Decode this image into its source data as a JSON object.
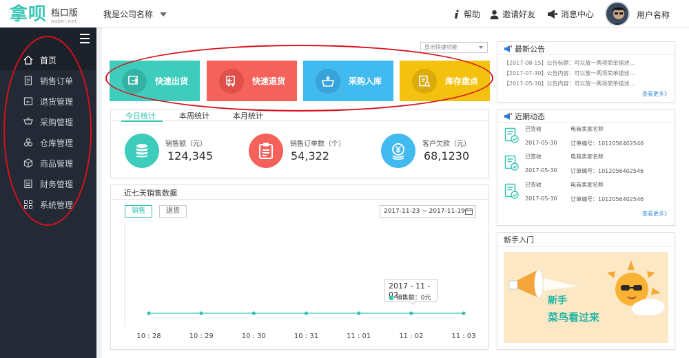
{
  "brand": {
    "logo_text": "拿呗",
    "sub": "档口版",
    "domain": "nabei.net",
    "color": "#3cc7b6"
  },
  "header": {
    "company": "我是公司名称",
    "nav": [
      {
        "label": "帮助",
        "icon": "info-icon"
      },
      {
        "label": "邀请好友",
        "icon": "user-icon"
      },
      {
        "label": "消息中心",
        "icon": "megaphone-icon"
      }
    ],
    "username": "用户名称"
  },
  "sidebar": {
    "items": [
      {
        "label": "首页",
        "icon": "home-icon",
        "active": true
      },
      {
        "label": "销售订单",
        "icon": "document-icon"
      },
      {
        "label": "退货管理",
        "icon": "return-icon"
      },
      {
        "label": "采购管理",
        "icon": "cart-icon"
      },
      {
        "label": "仓库管理",
        "icon": "boxes-icon"
      },
      {
        "label": "商品管理",
        "icon": "cube-icon"
      },
      {
        "label": "财务管理",
        "icon": "ledger-icon"
      },
      {
        "label": "系统管理",
        "icon": "grid-icon"
      }
    ]
  },
  "quick": {
    "selector": "显示快捷功能",
    "buttons": [
      {
        "label": "快速出货",
        "color": "#3ecdbc",
        "icon": "truck-out-icon"
      },
      {
        "label": "快速退货",
        "color": "#f5625b",
        "icon": "truck-return-icon"
      },
      {
        "label": "采购入库",
        "color": "#41baf0",
        "icon": "basket-icon"
      },
      {
        "label": "库存盘点",
        "color": "#f4c10f",
        "icon": "inventory-check-icon"
      }
    ]
  },
  "stats": {
    "tabs": [
      "今日统计",
      "本周统计",
      "本月统计"
    ],
    "items": [
      {
        "label": "销售额（元）",
        "value": "124,345",
        "color": "#3ecdbc",
        "icon": "coins-icon"
      },
      {
        "label": "销售订单数（个）",
        "value": "54,322",
        "color": "#f5625b",
        "icon": "clipboard-icon"
      },
      {
        "label": "客户欠款（元）",
        "value": "68,1230",
        "color": "#41baf0",
        "icon": "yen-coins-icon"
      }
    ]
  },
  "chart": {
    "title": "近七天销售数据",
    "toggle": [
      "销售",
      "退货"
    ],
    "date_range": "2017-11-23 ~ 2017-11-19",
    "tooltip": {
      "date": "2017 - 11 - 02",
      "label": "销售额：0元"
    }
  },
  "chart_data": {
    "type": "line",
    "x": [
      "10 : 28",
      "10 : 29",
      "10 : 30",
      "10 : 31",
      "11 : 01",
      "11 : 02",
      "11 : 03"
    ],
    "series": [
      {
        "name": "销售额",
        "values": [
          0,
          0,
          0,
          0,
          0,
          0,
          0
        ],
        "color": "#36c3b2"
      }
    ]
  },
  "announcements": {
    "title": "最新公告",
    "items": [
      "【2017-08-15】公告标题：可以放一两项简单描述...",
      "【2017-07-30】公告内容：可以放一两项简单描述...",
      "【2017-05-30】公告内容：可以放一两项简单描述..."
    ],
    "more": "查看更多》"
  },
  "activity": {
    "title": "近期动态",
    "items": [
      {
        "status": "已签收",
        "date": "2017-05-30",
        "seller": "电商卖家名称",
        "order": "订单编号：1012056402546"
      },
      {
        "status": "已签收",
        "date": "2017-05-30",
        "seller": "电商卖家名称",
        "order": "订单编号：1012056402546"
      },
      {
        "status": "已签收",
        "date": "2017-05-30",
        "seller": "电商卖家名称",
        "order": "订单编号：1012056402546"
      }
    ],
    "more": "查看更多》"
  },
  "guide": {
    "title": "新手入门",
    "line1": "新手",
    "line2": "菜鸟看过来"
  }
}
